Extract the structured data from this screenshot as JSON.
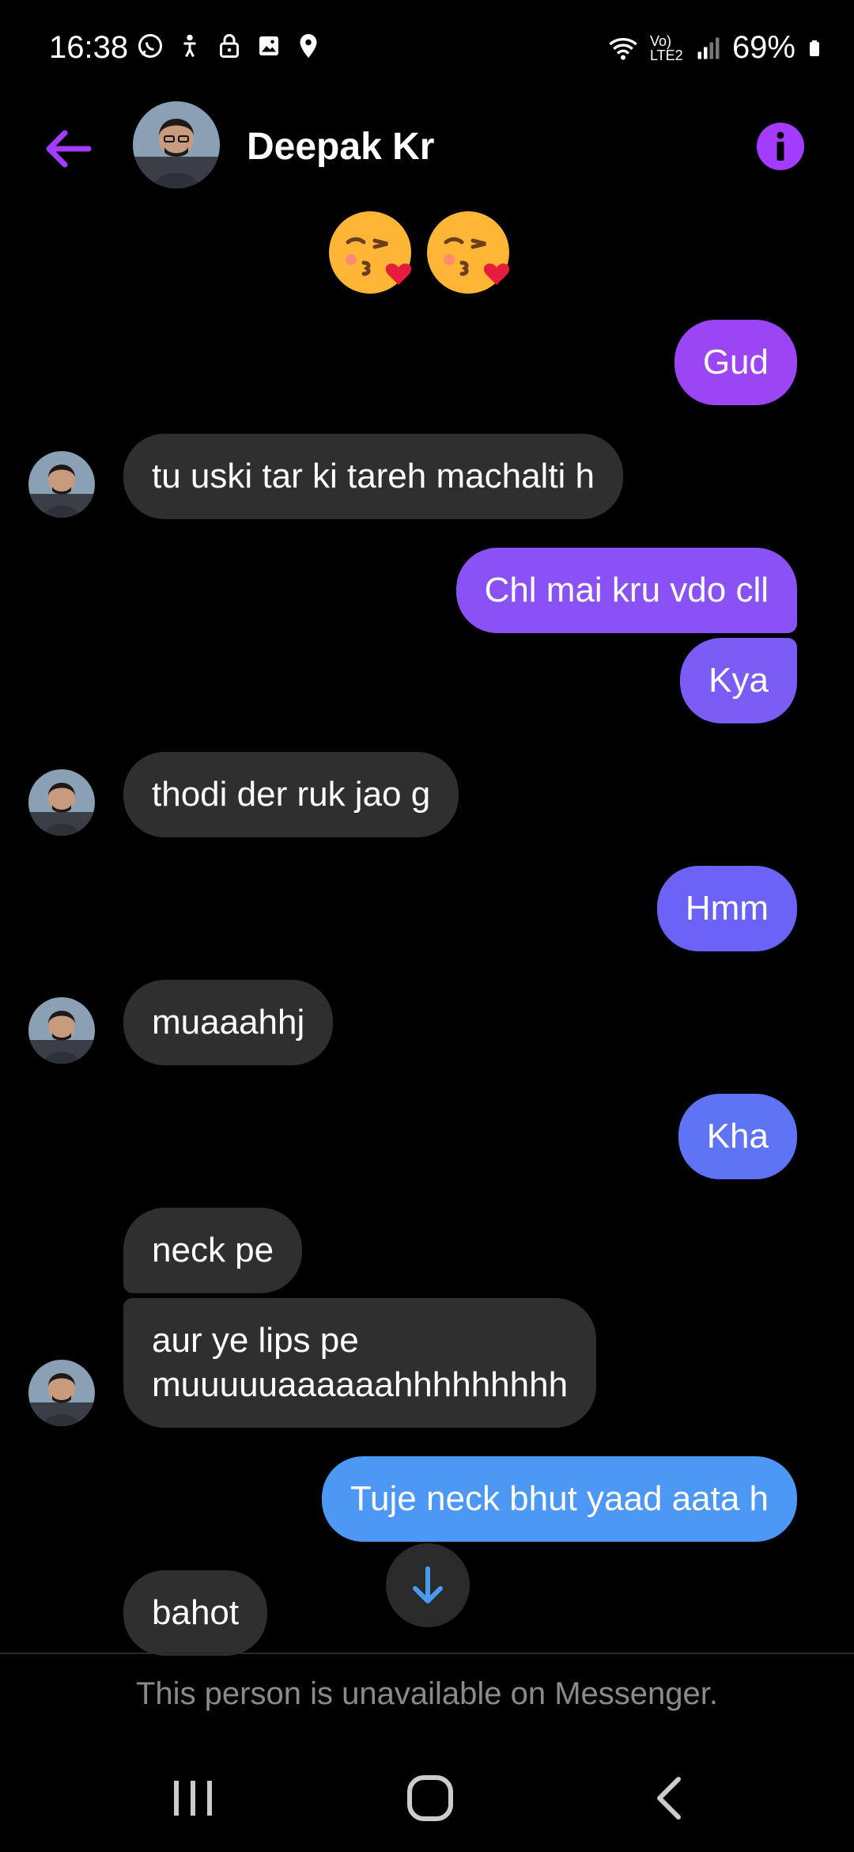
{
  "status_bar": {
    "time": "16:38",
    "battery": "69%",
    "network": "Vo) LTE2",
    "icons": [
      "whatsapp-icon",
      "accessibility-icon",
      "lock-icon",
      "gallery-icon",
      "location-icon",
      "wifi-icon",
      "signal-icon",
      "battery-icon"
    ]
  },
  "header": {
    "contact_name": "Deepak Kr",
    "back_icon": "arrow-left-icon",
    "info_icon": "info-icon",
    "accent": "#a33cff"
  },
  "emoji_message": [
    "kissing-heart-emoji",
    "kissing-heart-emoji"
  ],
  "messages": [
    {
      "text": "Gud",
      "dir": "out"
    },
    {
      "text": "tu uski tar ki tareh machalti h",
      "dir": "in"
    },
    {
      "text": "Chl mai kru vdo cll",
      "dir": "out"
    },
    {
      "text": "Kya",
      "dir": "out"
    },
    {
      "text": "thodi der ruk jao g",
      "dir": "in"
    },
    {
      "text": "Hmm",
      "dir": "out"
    },
    {
      "text": "muaaahhj",
      "dir": "in"
    },
    {
      "text": "Kha",
      "dir": "out"
    },
    {
      "text": "neck pe",
      "dir": "in"
    },
    {
      "text": "aur ye lips pe",
      "dir": "in"
    },
    {
      "text": "muuuuuaaaaaahhhhhhhhh",
      "dir": "in"
    },
    {
      "text": "Tuje neck bhut yaad aata h",
      "dir": "out"
    },
    {
      "text": "bahot",
      "dir": "in"
    }
  ],
  "out_colors": [
    "#9b45f5",
    "#8a52f5",
    "#7b5cf5",
    "#6b63f5",
    "#5f74f5",
    "#4d97f5"
  ],
  "in_color": "#2f2f2f",
  "footer": {
    "unavailable_text": "This person is unavailable on Messenger.",
    "scroll_icon": "arrow-down-icon"
  },
  "navbar": {
    "items": [
      "recents-icon",
      "home-icon",
      "back-icon"
    ]
  }
}
